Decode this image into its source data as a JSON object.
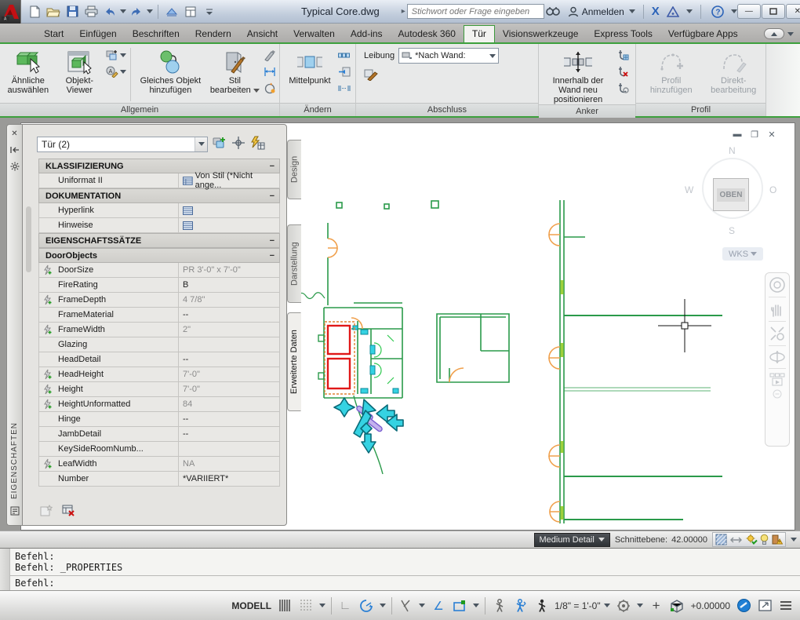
{
  "titlebar": {
    "doc_title": "Typical Core.dwg",
    "search_placeholder": "Stichwort oder Frage eingeben",
    "signin_label": "Anmelden"
  },
  "tabs": {
    "items": [
      "Start",
      "Einfügen",
      "Beschriften",
      "Rendern",
      "Ansicht",
      "Verwalten",
      "Add-ins",
      "Autodesk 360",
      "Tür",
      "Visionswerkzeuge",
      "Express Tools",
      "Verfügbare Apps"
    ],
    "active": "Tür"
  },
  "ribbon": {
    "allgemein": {
      "title": "Allgemein",
      "select_similar": "Ähnliche auswählen",
      "object_viewer": "Objekt-Viewer",
      "add_selected": "Gleiches Objekt hinzufügen",
      "edit_style": "Stil bearbeiten"
    },
    "aendern": {
      "title": "Ändern",
      "midpoint": "Mittelpunkt"
    },
    "abschluss": {
      "title": "Abschluss",
      "label": "Leibung",
      "combo_value": "*Nach Wand:"
    },
    "anker": {
      "title": "Anker",
      "reposition": "Innerhalb der Wand neu positionieren"
    },
    "profil": {
      "title": "Profil",
      "add_profile": "Profil hinzufügen",
      "direct_edit": "Direkt-bearbeitung"
    }
  },
  "palette": {
    "vertical_title": "EIGENSCHAFTEN",
    "selection": "Tür (2)",
    "sections": {
      "klassifizierung": "KLASSIFIZIERUNG",
      "dokumentation": "DOKUMENTATION",
      "eigenschaftssaetze": "EIGENSCHAFTSSÄTZE",
      "door_objects": "DoorObjects"
    },
    "klass_rows": [
      {
        "label": "Uniformat II",
        "value": "Von Stil (*Nicht ange..."
      }
    ],
    "doc_rows": [
      {
        "label": "Hyperlink"
      },
      {
        "label": "Hinweise"
      }
    ],
    "props": [
      {
        "label": "DoorSize",
        "value": "PR 3'-0\" x 7'-0\""
      },
      {
        "label": "FireRating",
        "value": "B"
      },
      {
        "label": "FrameDepth",
        "value": "4 7/8\""
      },
      {
        "label": "FrameMaterial",
        "value": "--"
      },
      {
        "label": "FrameWidth",
        "value": "2\""
      },
      {
        "label": "Glazing",
        "value": ""
      },
      {
        "label": "HeadDetail",
        "value": "--"
      },
      {
        "label": "HeadHeight",
        "value": "7'-0\""
      },
      {
        "label": "Height",
        "value": "7'-0\""
      },
      {
        "label": "HeightUnformatted",
        "value": "84"
      },
      {
        "label": "Hinge",
        "value": "--"
      },
      {
        "label": "JambDetail",
        "value": "--"
      },
      {
        "label": "KeySideRoomNumb...",
        "value": ""
      },
      {
        "label": "LeafWidth",
        "value": "NA"
      },
      {
        "label": "Number",
        "value": "*VARIIERT*"
      }
    ],
    "side_tabs": [
      "Design",
      "Darstellung",
      "Erweiterte Daten"
    ],
    "active_side_tab": "Erweiterte Daten"
  },
  "viewcube": {
    "north": "N",
    "west": "W",
    "east": "O",
    "south": "S",
    "top": "OBEN",
    "wcs": "WKS"
  },
  "canvas_bar": {
    "detail": "Medium Detail",
    "cut_label": "Schnittebene:",
    "cut_value": "42.00000"
  },
  "command": {
    "line1": "Befehl:",
    "line2": "Befehl: _PROPERTIES",
    "prompt": "Befehl:"
  },
  "statusbar": {
    "model": "MODELL",
    "scale": "1/8\" = 1'-0\"",
    "z": "+0.00000"
  }
}
